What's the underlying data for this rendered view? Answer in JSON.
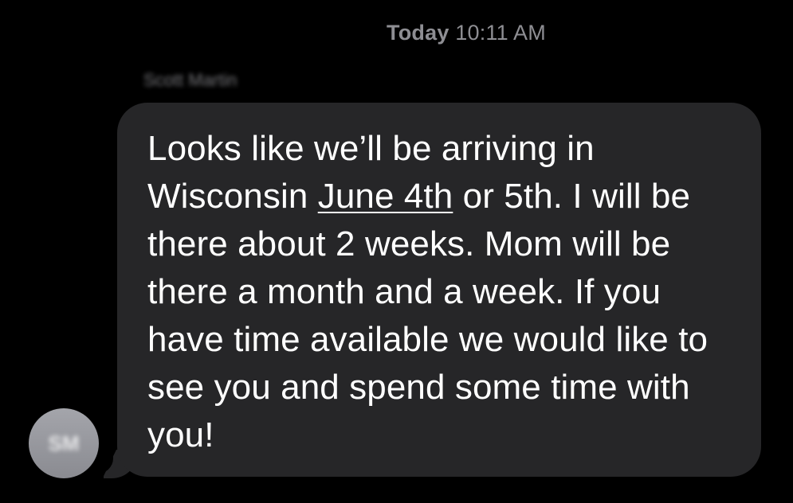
{
  "thread": {
    "timestamp_day": "Today",
    "timestamp_time": "10:11 AM",
    "sender_name": "Scott Martin"
  },
  "message": {
    "text_before_link": "Looks like we’ll be arriving in Wisconsin ",
    "date_link": "June 4th",
    "text_after_link": " or 5th. I will be there about 2 weeks. Mom will be there a month and a week. If you have time available we would like to see you and spend some time with you!"
  },
  "avatar": {
    "initials": "SM"
  },
  "colors": {
    "background": "#000000",
    "bubble": "#262628",
    "timestamp": "#8e8e93",
    "text": "#ffffff",
    "avatar": "#9a9ba1"
  }
}
